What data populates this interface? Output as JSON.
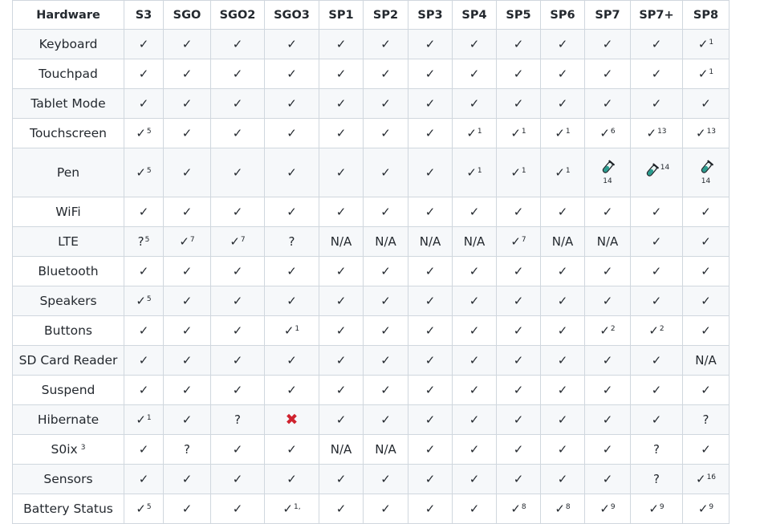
{
  "table": {
    "headers": [
      "Hardware",
      "S3",
      "SGO",
      "SGO2",
      "SGO3",
      "SP1",
      "SP2",
      "SP3",
      "SP4",
      "SP5",
      "SP6",
      "SP7",
      "SP7+",
      "SP8"
    ],
    "rows": [
      {
        "name": "Keyboard",
        "cells": [
          {
            "t": "✓"
          },
          {
            "t": "✓"
          },
          {
            "t": "✓"
          },
          {
            "t": "✓"
          },
          {
            "t": "✓"
          },
          {
            "t": "✓"
          },
          {
            "t": "✓"
          },
          {
            "t": "✓"
          },
          {
            "t": "✓"
          },
          {
            "t": "✓"
          },
          {
            "t": "✓"
          },
          {
            "t": "✓"
          },
          {
            "t": "✓",
            "s": "1"
          }
        ]
      },
      {
        "name": "Touchpad",
        "cells": [
          {
            "t": "✓"
          },
          {
            "t": "✓"
          },
          {
            "t": "✓"
          },
          {
            "t": "✓"
          },
          {
            "t": "✓"
          },
          {
            "t": "✓"
          },
          {
            "t": "✓"
          },
          {
            "t": "✓"
          },
          {
            "t": "✓"
          },
          {
            "t": "✓"
          },
          {
            "t": "✓"
          },
          {
            "t": "✓"
          },
          {
            "t": "✓",
            "s": "1"
          }
        ]
      },
      {
        "name": "Tablet Mode",
        "cells": [
          {
            "t": "✓"
          },
          {
            "t": "✓"
          },
          {
            "t": "✓"
          },
          {
            "t": "✓"
          },
          {
            "t": "✓"
          },
          {
            "t": "✓"
          },
          {
            "t": "✓"
          },
          {
            "t": "✓"
          },
          {
            "t": "✓"
          },
          {
            "t": "✓"
          },
          {
            "t": "✓"
          },
          {
            "t": "✓"
          },
          {
            "t": "✓"
          }
        ]
      },
      {
        "name": "Touchscreen",
        "cells": [
          {
            "t": "✓",
            "s": "5"
          },
          {
            "t": "✓"
          },
          {
            "t": "✓"
          },
          {
            "t": "✓"
          },
          {
            "t": "✓"
          },
          {
            "t": "✓"
          },
          {
            "t": "✓"
          },
          {
            "t": "✓",
            "s": "1"
          },
          {
            "t": "✓",
            "s": "1"
          },
          {
            "t": "✓",
            "s": "1"
          },
          {
            "t": "✓",
            "s": "6"
          },
          {
            "t": "✓",
            "s": "13"
          },
          {
            "t": "✓",
            "s": "13"
          }
        ]
      },
      {
        "name": "Pen",
        "cells": [
          {
            "t": "✓",
            "s": "5"
          },
          {
            "t": "✓"
          },
          {
            "t": "✓"
          },
          {
            "t": "✓"
          },
          {
            "t": "✓"
          },
          {
            "t": "✓"
          },
          {
            "t": "✓"
          },
          {
            "t": "✓",
            "s": "1"
          },
          {
            "t": "✓",
            "s": "1"
          },
          {
            "t": "✓",
            "s": "1"
          },
          {
            "t": "",
            "icon": "test-tube-icon",
            "note": "14",
            "pos": "below"
          },
          {
            "t": "",
            "icon": "test-tube-icon",
            "note": "14",
            "pos": "side"
          },
          {
            "t": "",
            "icon": "test-tube-icon",
            "note": "14",
            "pos": "below"
          }
        ]
      },
      {
        "name": "WiFi",
        "cells": [
          {
            "t": "✓"
          },
          {
            "t": "✓"
          },
          {
            "t": "✓"
          },
          {
            "t": "✓"
          },
          {
            "t": "✓"
          },
          {
            "t": "✓"
          },
          {
            "t": "✓"
          },
          {
            "t": "✓"
          },
          {
            "t": "✓"
          },
          {
            "t": "✓"
          },
          {
            "t": "✓"
          },
          {
            "t": "✓"
          },
          {
            "t": "✓"
          }
        ]
      },
      {
        "name": "LTE",
        "cells": [
          {
            "t": "?",
            "s": "5"
          },
          {
            "t": "✓",
            "s": "7"
          },
          {
            "t": "✓",
            "s": "7"
          },
          {
            "t": "?"
          },
          {
            "t": "N/A"
          },
          {
            "t": "N/A"
          },
          {
            "t": "N/A"
          },
          {
            "t": "N/A"
          },
          {
            "t": "✓",
            "s": "7"
          },
          {
            "t": "N/A"
          },
          {
            "t": "N/A"
          },
          {
            "t": "✓"
          },
          {
            "t": "✓"
          }
        ]
      },
      {
        "name": "Bluetooth",
        "cells": [
          {
            "t": "✓"
          },
          {
            "t": "✓"
          },
          {
            "t": "✓"
          },
          {
            "t": "✓"
          },
          {
            "t": "✓"
          },
          {
            "t": "✓"
          },
          {
            "t": "✓"
          },
          {
            "t": "✓"
          },
          {
            "t": "✓"
          },
          {
            "t": "✓"
          },
          {
            "t": "✓"
          },
          {
            "t": "✓"
          },
          {
            "t": "✓"
          }
        ]
      },
      {
        "name": "Speakers",
        "cells": [
          {
            "t": "✓",
            "s": "5"
          },
          {
            "t": "✓"
          },
          {
            "t": "✓"
          },
          {
            "t": "✓"
          },
          {
            "t": "✓"
          },
          {
            "t": "✓"
          },
          {
            "t": "✓"
          },
          {
            "t": "✓"
          },
          {
            "t": "✓"
          },
          {
            "t": "✓"
          },
          {
            "t": "✓"
          },
          {
            "t": "✓"
          },
          {
            "t": "✓"
          }
        ]
      },
      {
        "name": "Buttons",
        "cells": [
          {
            "t": "✓"
          },
          {
            "t": "✓"
          },
          {
            "t": "✓"
          },
          {
            "t": "✓",
            "s": "1"
          },
          {
            "t": "✓"
          },
          {
            "t": "✓"
          },
          {
            "t": "✓"
          },
          {
            "t": "✓"
          },
          {
            "t": "✓"
          },
          {
            "t": "✓"
          },
          {
            "t": "✓",
            "s": "2"
          },
          {
            "t": "✓",
            "s": "2"
          },
          {
            "t": "✓"
          }
        ]
      },
      {
        "name": "SD Card Reader",
        "cells": [
          {
            "t": "✓"
          },
          {
            "t": "✓"
          },
          {
            "t": "✓"
          },
          {
            "t": "✓"
          },
          {
            "t": "✓"
          },
          {
            "t": "✓"
          },
          {
            "t": "✓"
          },
          {
            "t": "✓"
          },
          {
            "t": "✓"
          },
          {
            "t": "✓"
          },
          {
            "t": "✓"
          },
          {
            "t": "✓"
          },
          {
            "t": "N/A"
          }
        ]
      },
      {
        "name": "Suspend",
        "cells": [
          {
            "t": "✓"
          },
          {
            "t": "✓"
          },
          {
            "t": "✓"
          },
          {
            "t": "✓"
          },
          {
            "t": "✓"
          },
          {
            "t": "✓"
          },
          {
            "t": "✓"
          },
          {
            "t": "✓"
          },
          {
            "t": "✓"
          },
          {
            "t": "✓"
          },
          {
            "t": "✓"
          },
          {
            "t": "✓"
          },
          {
            "t": "✓"
          }
        ]
      },
      {
        "name": "Hibernate",
        "cells": [
          {
            "t": "✓",
            "s": "1"
          },
          {
            "t": "✓"
          },
          {
            "t": "?"
          },
          {
            "t": "✖",
            "x": true
          },
          {
            "t": "✓"
          },
          {
            "t": "✓"
          },
          {
            "t": "✓"
          },
          {
            "t": "✓"
          },
          {
            "t": "✓"
          },
          {
            "t": "✓"
          },
          {
            "t": "✓"
          },
          {
            "t": "✓"
          },
          {
            "t": "?"
          }
        ]
      },
      {
        "name": "S0ix",
        "name_sup": "3",
        "cells": [
          {
            "t": "✓"
          },
          {
            "t": "?"
          },
          {
            "t": "✓"
          },
          {
            "t": "✓"
          },
          {
            "t": "N/A"
          },
          {
            "t": "N/A"
          },
          {
            "t": "✓"
          },
          {
            "t": "✓"
          },
          {
            "t": "✓"
          },
          {
            "t": "✓"
          },
          {
            "t": "✓"
          },
          {
            "t": "?"
          },
          {
            "t": "✓"
          }
        ]
      },
      {
        "name": "Sensors",
        "cells": [
          {
            "t": "✓"
          },
          {
            "t": "✓"
          },
          {
            "t": "✓"
          },
          {
            "t": "✓"
          },
          {
            "t": "✓"
          },
          {
            "t": "✓"
          },
          {
            "t": "✓"
          },
          {
            "t": "✓"
          },
          {
            "t": "✓"
          },
          {
            "t": "✓"
          },
          {
            "t": "✓"
          },
          {
            "t": "?"
          },
          {
            "t": "✓",
            "s": "16"
          }
        ]
      },
      {
        "name": "Battery Status",
        "cells": [
          {
            "t": "✓",
            "s": "5"
          },
          {
            "t": "✓"
          },
          {
            "t": "✓"
          },
          {
            "t": "✓",
            "s": "1,"
          },
          {
            "t": "✓"
          },
          {
            "t": "✓"
          },
          {
            "t": "✓"
          },
          {
            "t": "✓"
          },
          {
            "t": "✓",
            "s": "8"
          },
          {
            "t": "✓",
            "s": "8"
          },
          {
            "t": "✓",
            "s": "9"
          },
          {
            "t": "✓",
            "s": "9"
          },
          {
            "t": "✓",
            "s": "9"
          }
        ]
      }
    ]
  },
  "colors": {
    "border": "#d0d7de",
    "stripe": "#f6f8fa",
    "cross": "#cf222e",
    "tube": "#2a9d8f"
  }
}
